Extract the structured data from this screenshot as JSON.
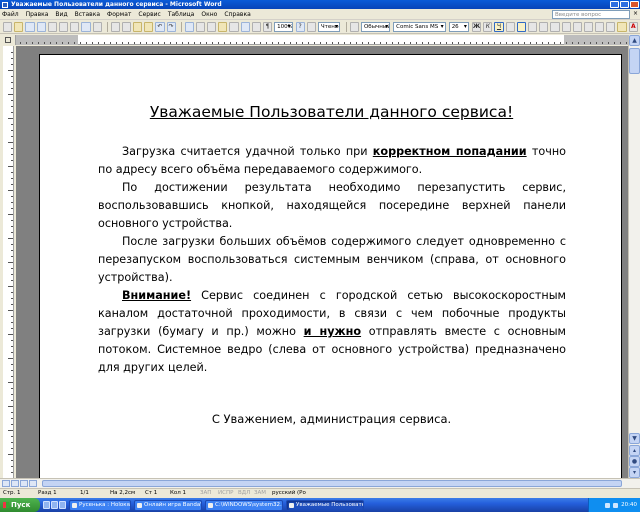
{
  "window": {
    "title": "Уважаемые Пользователи данного сервиса - Microsoft Word"
  },
  "menu": {
    "items": [
      "Файл",
      "Правка",
      "Вид",
      "Вставка",
      "Формат",
      "Сервис",
      "Таблица",
      "Окно",
      "Справка"
    ],
    "help_placeholder": "Введите вопрос"
  },
  "toolbar": {
    "zoom": "100%",
    "view_label": "Чтение",
    "style": "Обычный",
    "font": "Comic Sans MS",
    "size": "26",
    "bold": "Ж",
    "italic": "К",
    "underline": "Ч"
  },
  "document": {
    "heading": "Уважаемые Пользователи данного сервиса!",
    "p1_start": "Загрузка считается удачной только при ",
    "p1_ul": "корректном попадании",
    "p1_end": " точно по адресу всего объёма передаваемого содержимого.",
    "p2": "По достижении результата необходимо перезапустить сервис, воспользовавшись кнопкой, находящейся посередине верхней панели основного устройства.",
    "p3": "После загрузки больших объёмов содержимого следует одновременно с перезапуском воспользоваться системным венчиком (справа, от основного устройства).",
    "p4_ul1": "Внимание!",
    "p4_a": " Сервис соединен с городской сетью высокоскоростным каналом достаточной проходимости, в связи с чем побочные продукты загрузки (бумагу и пр.) можно ",
    "p4_ul2": " и нужно",
    "p4_b": " отправлять вместе с основным потоком. Системное ведро (слева от основного устройства) предназначено для других целей.",
    "signature": "С Уважением, администрация сервиса."
  },
  "status": {
    "page": "Стр. 1",
    "section": "Разд 1",
    "pages": "1/1",
    "position": "На 2,2см",
    "line": "Ст 1",
    "column": "Кол 1",
    "modes": [
      "ЗАП",
      "ИСПР",
      "ВДЛ",
      "ЗАМ"
    ],
    "language": "русский (Ро"
  },
  "taskbar": {
    "start": "Пуск",
    "tasks": [
      "Русенька : Нoloкwas.ru -...",
      "Онлайн игра BandaWars...",
      "C:\\WINDOWS\\system32...",
      "Уважаемые Пользовате..."
    ],
    "clock": "20:40"
  }
}
